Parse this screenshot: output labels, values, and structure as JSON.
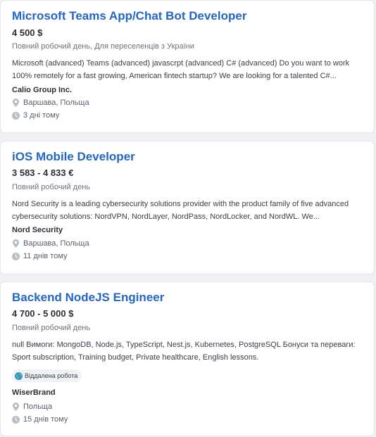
{
  "jobs": [
    {
      "title": "Microsoft Teams App/Chat Bot Developer",
      "salary": "4 500 $",
      "employment": "Повний робочий день, Для переселенців з України",
      "description": "Microsoft (advanced) Teams (advanced) javascrpt (advanced) C# (advanced) Do you want to work 100% remotely for a fast growing, American fintech startup? We are looking for a talented C#...",
      "company": "Calio Group Inc.",
      "location": "Варшава, Польща",
      "posted": "3 дні тому"
    },
    {
      "title": "iOS Mobile Developer",
      "salary": "3 583 - 4 833 €",
      "employment": "Повний робочий день",
      "description": "Nord Security is a leading cybersecurity solutions provider with the product family of five advanced cybersecurity solutions: NordVPN, NordLayer, NordPass, NordLocker, and NordWL. We...",
      "company": "Nord Security",
      "location": "Варшава, Польща",
      "posted": "11 днів тому"
    },
    {
      "title": "Backend NodeJS Engineer",
      "salary": "4 700 - 5 000 $",
      "employment": "Повний робочий день",
      "description": "null Вимоги: MongoDB, Node.js, TypeScript, Nest.js, Kubernetes, PostgreSQL Бонуси та переваги: Sport subscription, Training budget, Private healthcare, English lessons.",
      "badge": "Віддалена робота",
      "company": "WiserBrand",
      "location": "Польща",
      "posted": "15 днів тому"
    }
  ],
  "icons": {
    "location": "location-pin-icon",
    "time": "clock-icon",
    "remote": "globe-icon"
  },
  "colors": {
    "title": "#2466c4",
    "background": "#eef0f4",
    "card": "#ffffff"
  }
}
